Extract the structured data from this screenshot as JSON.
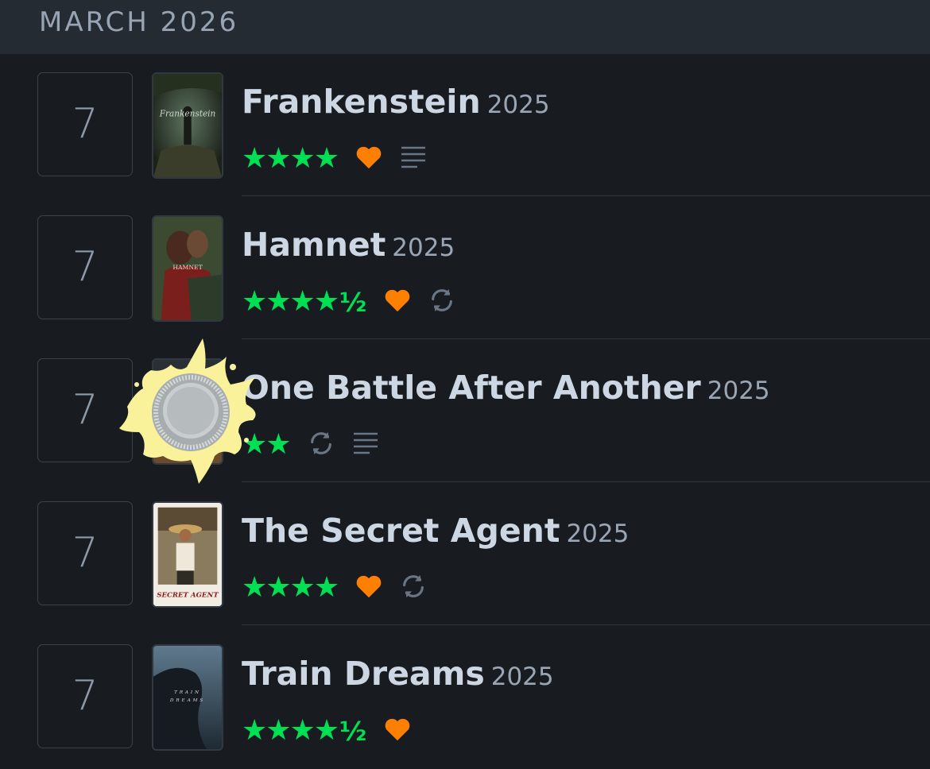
{
  "header": {
    "month": "MARCH 2026"
  },
  "colors": {
    "star": "#00e054",
    "heart": "#ff8000",
    "icon_grey": "#6b7684"
  },
  "entries": [
    {
      "day": "7",
      "title": "Frankenstein",
      "year": "2025",
      "rating": 4,
      "stars": "★★★★",
      "half": "",
      "liked": true,
      "rewatch": false,
      "review": true,
      "poster_icon": "frankenstein-poster"
    },
    {
      "day": "7",
      "title": "Hamnet",
      "year": "2025",
      "rating": 4.5,
      "stars": "★★★★",
      "half": "½",
      "liked": true,
      "rewatch": true,
      "review": false,
      "poster_icon": "hamnet-poster"
    },
    {
      "day": "7",
      "title": "One Battle After Another",
      "year": "2025",
      "rating": 2,
      "stars": "★★",
      "half": "",
      "liked": false,
      "rewatch": true,
      "review": true,
      "poster_icon": "one-battle-poster"
    },
    {
      "day": "7",
      "title": "The Secret Agent",
      "year": "2025",
      "rating": 4,
      "stars": "★★★★",
      "half": "",
      "liked": true,
      "rewatch": true,
      "review": false,
      "poster_icon": "secret-agent-poster",
      "poster_text": "SECRET AGENT"
    },
    {
      "day": "7",
      "title": "Train Dreams",
      "year": "2025",
      "rating": 4.5,
      "stars": "★★★★",
      "half": "½",
      "liked": true,
      "rewatch": false,
      "review": false,
      "poster_icon": "train-dreams-poster"
    }
  ]
}
